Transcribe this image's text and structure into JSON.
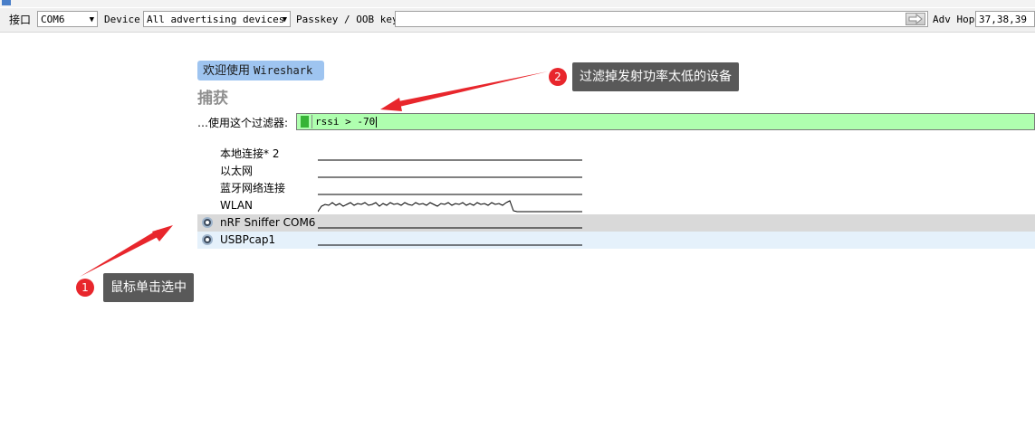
{
  "toolbar": {
    "interface_label": "接口",
    "interface_value": "COM6",
    "device_label": "Device",
    "device_value": "All advertising devices",
    "passkey_label": "Passkey / OOB key",
    "passkey_value": "",
    "adv_hop_label": "Adv Hop",
    "adv_hop_value": "37,38,39"
  },
  "welcome": {
    "prefix": "欢迎使用 ",
    "app": "Wireshark"
  },
  "capture": {
    "title": "捕获",
    "filter_label": "…使用这个过滤器:",
    "filter_value": "rssi > -70"
  },
  "interfaces": [
    {
      "name": "本地连接* 2",
      "icon": "none",
      "state": "normal"
    },
    {
      "name": "以太网",
      "icon": "none",
      "state": "normal"
    },
    {
      "name": "蓝牙网络连接",
      "icon": "none",
      "state": "normal"
    },
    {
      "name": "WLAN",
      "icon": "none",
      "state": "normal",
      "activity": "sparkline"
    },
    {
      "name": "nRF Sniffer COM6",
      "icon": "extcap-gear-icon",
      "state": "selected"
    },
    {
      "name": "USBPcap1",
      "icon": "extcap-gear-icon",
      "state": "hover"
    }
  ],
  "annotations": [
    {
      "number": "1",
      "text": "鼠标单击选中"
    },
    {
      "number": "2",
      "text": "过滤掉发射功率太低的设备"
    }
  ],
  "colors": {
    "filter_valid": "#afffaf",
    "selected_row": "#d9d9d9",
    "hover_row": "#e5f1fb",
    "welcome_bg": "#9ec4f0",
    "annotation_red": "#e8262c",
    "callout_bg": "#595959"
  }
}
